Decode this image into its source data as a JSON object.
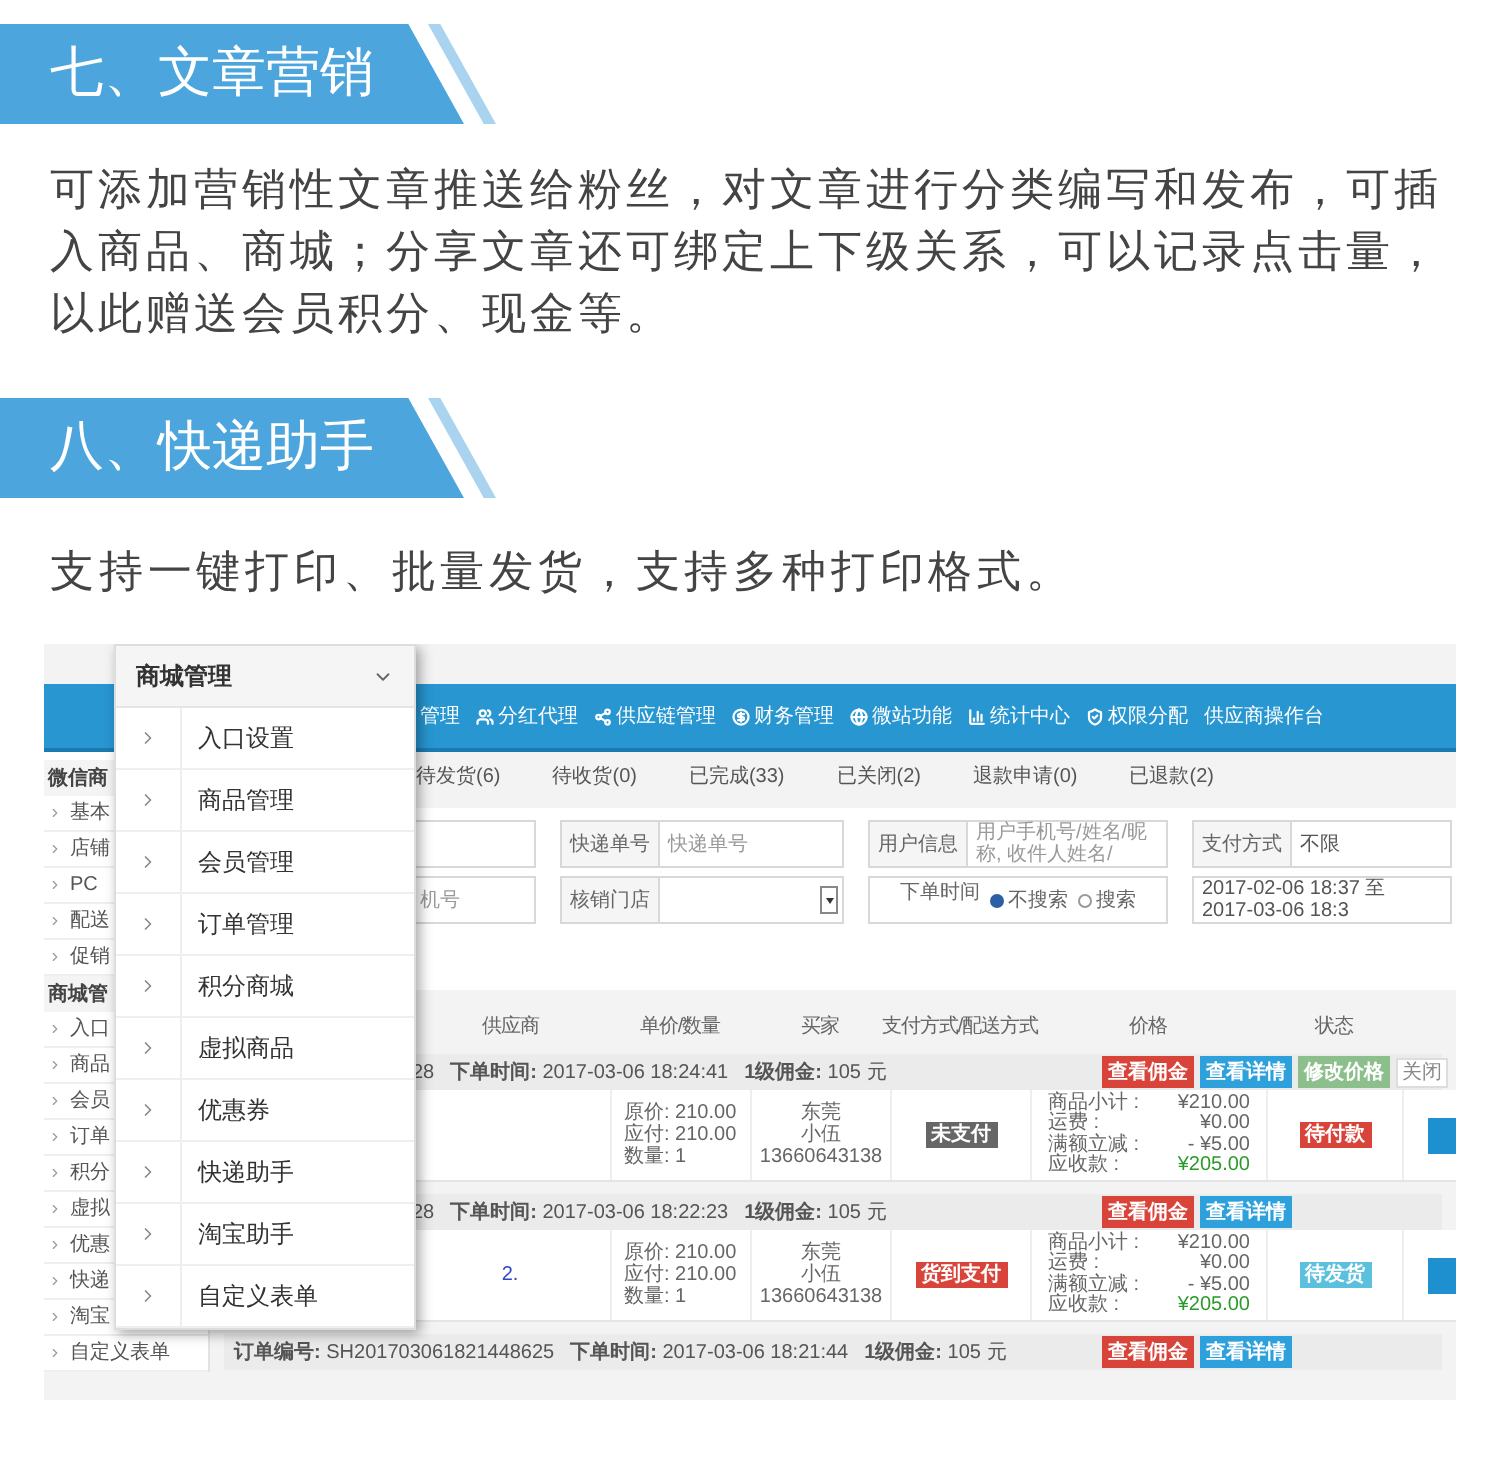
{
  "article_section": {
    "heading": "七、文章营销",
    "body": "可添加营销性文章推送给粉丝，对文章进行分类编写和发布，可插入商品、商城；分享文章还可绑定上下级关系，可以记录点击量，以此赠送会员积分、现金等。"
  },
  "express_section": {
    "heading": "八、快递助手",
    "body": "支持一键打印、批量发货，支持多种打印格式。"
  },
  "screenshot": {
    "nav": [
      "管理",
      "分红代理",
      "供应链管理",
      "财务管理",
      "微站功能",
      "统计中心",
      "权限分配",
      "供应商操作台"
    ],
    "sidebar": [
      {
        "kind": "group",
        "label": "微信商"
      },
      {
        "kind": "item",
        "label": "基本"
      },
      {
        "kind": "item",
        "label": "店铺"
      },
      {
        "kind": "item",
        "label": "PC"
      },
      {
        "kind": "item",
        "label": "配送"
      },
      {
        "kind": "item",
        "label": "促销"
      },
      {
        "kind": "group",
        "label": "商城管"
      },
      {
        "kind": "item",
        "label": "入口"
      },
      {
        "kind": "item",
        "label": "商品"
      },
      {
        "kind": "item",
        "label": "会员"
      },
      {
        "kind": "item",
        "label": "订单"
      },
      {
        "kind": "item",
        "label": "积分"
      },
      {
        "kind": "item",
        "label": "虚拟"
      },
      {
        "kind": "item",
        "label": "优惠"
      },
      {
        "kind": "item",
        "label": "快递"
      },
      {
        "kind": "item",
        "label": "淘宝"
      },
      {
        "kind": "item",
        "label": "自定义表单"
      }
    ],
    "tabs": [
      "待发货(6)",
      "待收货(0)",
      "已完成(33)",
      "已关闭(2)",
      "退款申请(0)",
      "已退款(2)"
    ],
    "filters": [
      {
        "kind": "blank"
      },
      {
        "kind": "field",
        "label": "快递单号",
        "placeholder": "快递单号"
      },
      {
        "kind": "field",
        "label": "用户信息",
        "placeholder": "用户手机号/姓名/昵称, 收件人姓名/"
      },
      {
        "kind": "field",
        "label": "支付方式",
        "value": "不限"
      },
      {
        "kind": "field",
        "placeholder": "机号"
      },
      {
        "kind": "select",
        "label": "核销门店"
      },
      {
        "kind": "radio",
        "label": "下单时间",
        "options": [
          {
            "label": "不搜索",
            "selected": true
          },
          {
            "label": "搜索",
            "selected": false
          }
        ]
      },
      {
        "kind": "field",
        "value": "2017-02-06 18:37 至 2017-03-06 18:3"
      }
    ],
    "columns": [
      "供应商",
      "单价/数量",
      "买家",
      "支付方式/配送方式",
      "价格",
      "状态"
    ],
    "orders": [
      {
        "covered": true,
        "order": "28",
        "time": "**下单时间:** 2017-03-06 18:24:41",
        "commission": "**1级佣金:** 105 元",
        "buttons": [
          {
            "label": "查看佣金",
            "kind": "danger"
          },
          {
            "label": "查看详情",
            "kind": "info"
          },
          {
            "label": "修改价格",
            "kind": "success"
          }
        ],
        "close": "关闭",
        "details": {
          "unit": [
            "原价: 210.00",
            "应付: 210.00",
            "数量: 1"
          ],
          "buyer": [
            "东莞",
            "小伍",
            "13660643138"
          ],
          "payment": {
            "label": "未支付",
            "kind": "unpaid"
          },
          "price": [
            {
              "label": "商品小计 :",
              "value": "¥210.00",
              "total": false
            },
            {
              "label": "运费 :",
              "value": "¥0.00",
              "total": false
            },
            {
              "label": "满额立减 :",
              "value": "- ¥5.00",
              "total": false
            },
            {
              "label": "应收款 :",
              "value": "¥205.00",
              "total": true
            }
          ],
          "status": {
            "label": "待付款",
            "kind": "pending_payment"
          }
        }
      },
      {
        "covered": true,
        "order": "28",
        "time": "**下单时间:** 2017-03-06 18:22:23",
        "commission": "**1级佣金:** 105 元",
        "buttons": [
          {
            "label": "查看佣金",
            "kind": "danger"
          },
          {
            "label": "查看详情",
            "kind": "info"
          }
        ],
        "details": {
          "goods": "2.",
          "unit": [
            "原价: 210.00",
            "应付: 210.00",
            "数量: 1"
          ],
          "buyer": [
            "东莞",
            "小伍",
            "13660643138"
          ],
          "payment": {
            "label": "货到支付",
            "kind": "cod"
          },
          "price": [
            {
              "label": "商品小计 :",
              "value": "¥210.00",
              "total": false
            },
            {
              "label": "运费 :",
              "value": "¥0.00",
              "total": false
            },
            {
              "label": "满额立减 :",
              "value": "- ¥5.00",
              "total": false
            },
            {
              "label": "应收款 :",
              "value": "¥205.00",
              "total": true
            }
          ],
          "status": {
            "label": "待发货",
            "kind": "pending_shipment"
          }
        }
      },
      {
        "covered": false,
        "order": "**订单编号:** SH201703061821448625",
        "time": "**下单时间:** 2017-03-06 18:21:44",
        "commission": "**1级佣金:** 105 元",
        "buttons": [
          {
            "label": "查看佣金",
            "kind": "danger"
          },
          {
            "label": "查看详情",
            "kind": "info"
          }
        ]
      }
    ],
    "menu": {
      "title": "商城管理",
      "items": [
        "入口设置",
        "商品管理",
        "会员管理",
        "订单管理",
        "积分商城",
        "虚拟商品",
        "优惠券",
        "快递助手",
        "淘宝助手",
        "自定义表单"
      ]
    }
  }
}
